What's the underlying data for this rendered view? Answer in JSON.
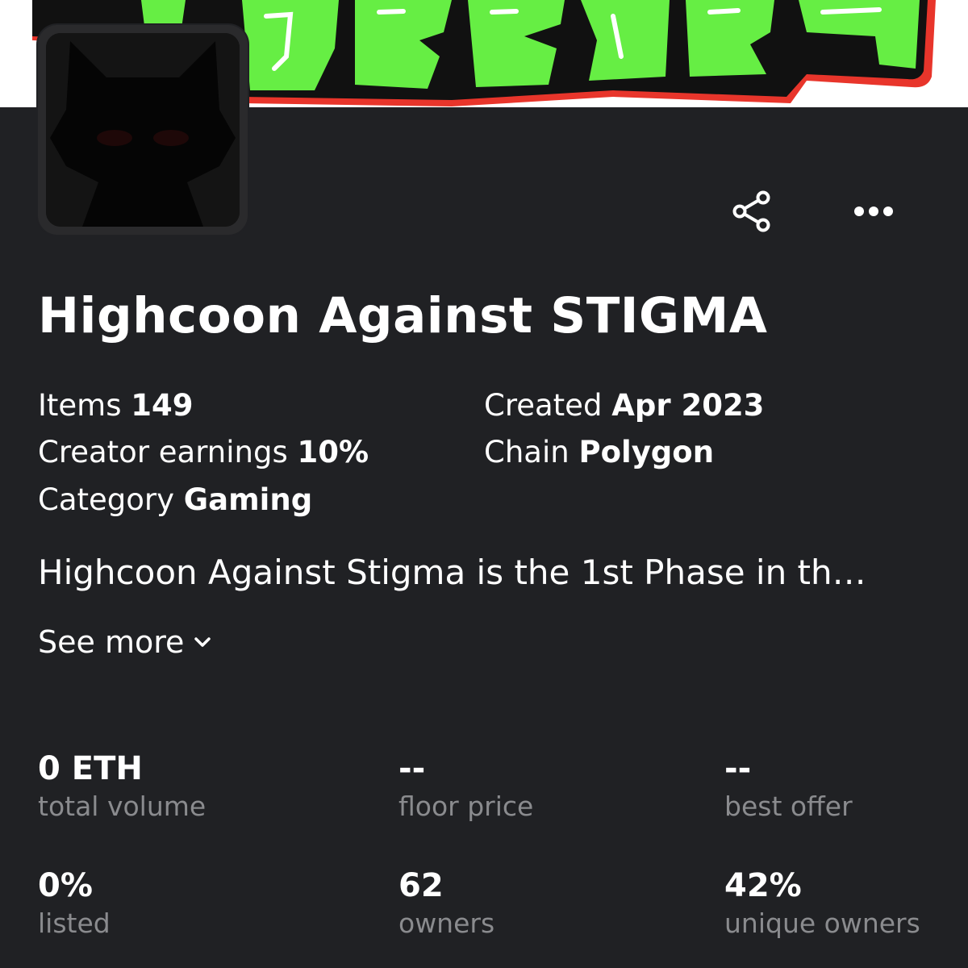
{
  "collection": {
    "title": "Highcoon Against STIGMA",
    "description": "Highcoon Against Stigma is the 1st Phase in th…",
    "see_more_label": "See more"
  },
  "meta": {
    "items": {
      "label": "Items",
      "value": "149"
    },
    "creator_earnings": {
      "label": "Creator earnings",
      "value": "10%"
    },
    "category": {
      "label": "Category",
      "value": "Gaming"
    },
    "created": {
      "label": "Created",
      "value": "Apr 2023"
    },
    "chain": {
      "label": "Chain",
      "value": "Polygon"
    }
  },
  "stats": [
    {
      "value": "0 ETH",
      "label": "total volume"
    },
    {
      "value": "--",
      "label": "floor price"
    },
    {
      "value": "--",
      "label": "best offer"
    },
    {
      "value": "0%",
      "label": "listed"
    },
    {
      "value": "62",
      "label": "owners"
    },
    {
      "value": "42%",
      "label": "unique owners"
    }
  ],
  "icons": {
    "share": "share-icon",
    "more": "more-horizontal-icon",
    "see_more": "chevron-down-icon"
  },
  "colors": {
    "background": "#202124",
    "text_primary": "#ffffff",
    "text_secondary": "#8a8b8e",
    "banner_green": "#66ee44",
    "banner_red": "#e8352b"
  }
}
